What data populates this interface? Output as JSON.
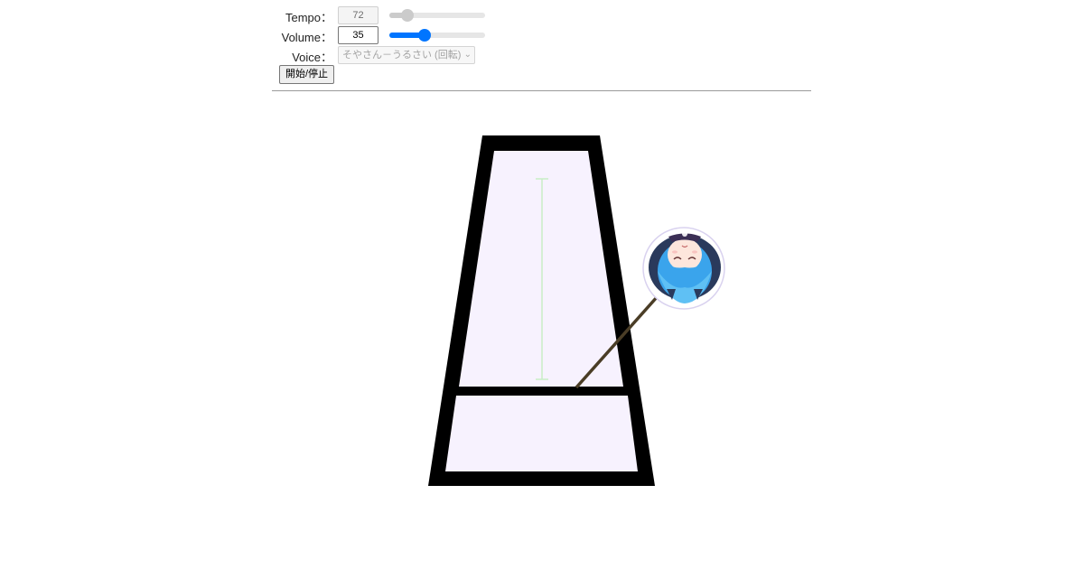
{
  "controls": {
    "tempo": {
      "label": "Tempo：",
      "value": "72",
      "min": 20,
      "max": 400,
      "level": 0.14
    },
    "volume": {
      "label": "Volume：",
      "value": "35",
      "level": 0.35
    },
    "voice": {
      "label": "Voice：",
      "selected": "そやさん－うるさい (回転)"
    },
    "start_stop_label": "開始/停止"
  },
  "colors": {
    "frame": "#000000",
    "frame_fill": "#f7f2fe",
    "guide_line": "#c8eec6",
    "pendulum_rod": "#4a3d26",
    "slider_active": "#0075ff"
  },
  "metronome": {
    "pendulum_angle_deg": 40,
    "bob_image": "avatar-face (upside down, blue hair)"
  }
}
